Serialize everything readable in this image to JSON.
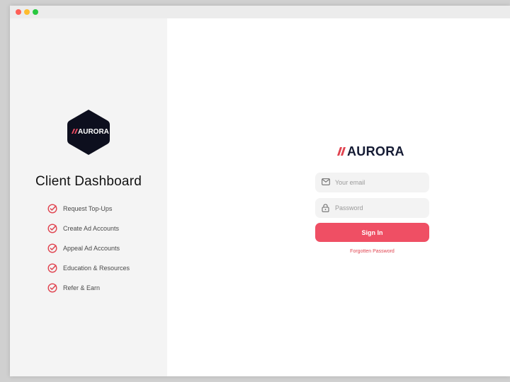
{
  "window": {
    "controls": [
      "close",
      "minimize",
      "maximize"
    ]
  },
  "left_panel": {
    "logo_text": "AURORA",
    "title": "Client Dashboard",
    "features": [
      {
        "label": "Request Top-Ups",
        "icon": "check-circle-icon"
      },
      {
        "label": "Create Ad Accounts",
        "icon": "check-circle-icon"
      },
      {
        "label": "Appeal Ad Accounts",
        "icon": "check-circle-icon"
      },
      {
        "label": "Education & Resources",
        "icon": "check-circle-icon"
      },
      {
        "label": "Refer & Earn",
        "icon": "check-circle-icon"
      }
    ]
  },
  "login": {
    "brand_text": "AURORA",
    "email": {
      "value": "",
      "placeholder": "Your email",
      "icon": "mail-icon"
    },
    "password": {
      "value": "",
      "placeholder": "Password",
      "icon": "lock-icon"
    },
    "signin_label": "Sign In",
    "forgot_label": "Forgotten Password"
  },
  "colors": {
    "accent": "#ef4f64",
    "brand_dark": "#141a33",
    "logo_bg": "#0d0f1e",
    "panel_bg": "#f4f4f4"
  }
}
